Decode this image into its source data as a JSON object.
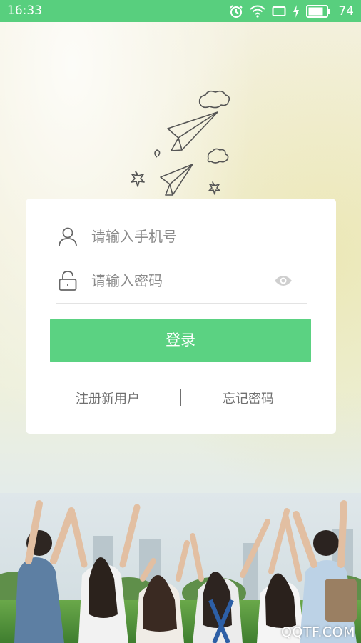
{
  "status_bar": {
    "time": "16:33",
    "battery_percent": "74",
    "icons": [
      "alarm-icon",
      "wifi-icon",
      "screen-rotate-icon",
      "charging-icon",
      "battery-icon"
    ],
    "background": "#58cf7e"
  },
  "login": {
    "phone_placeholder": "请输入手机号",
    "password_placeholder": "请输入密码",
    "phone_value": "",
    "password_value": "",
    "login_button": "登录",
    "register_link": "注册新用户",
    "forgot_link": "忘记密码",
    "accent_color": "#5bd282"
  },
  "watermark": "QQTF.COM"
}
